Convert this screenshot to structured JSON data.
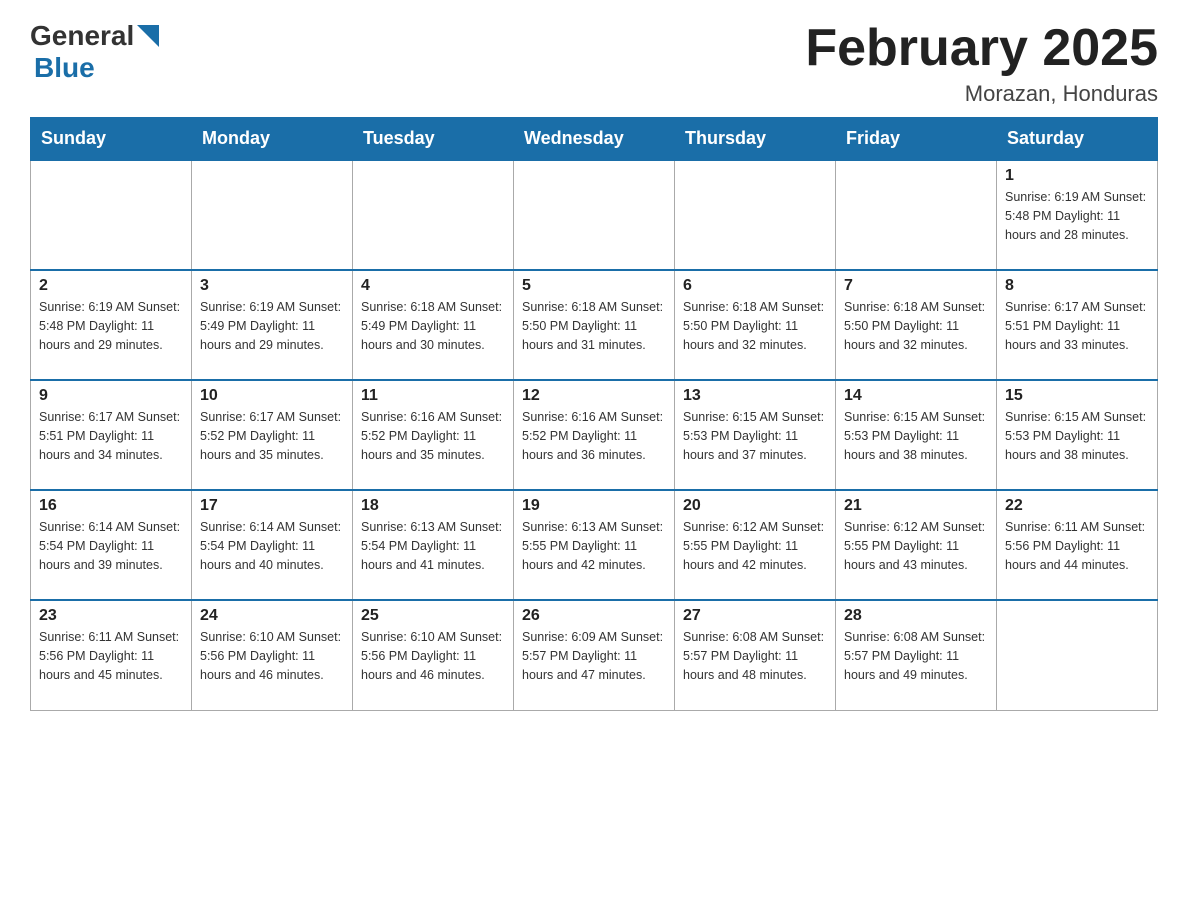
{
  "header": {
    "logo_general": "General",
    "logo_blue": "Blue",
    "title": "February 2025",
    "subtitle": "Morazan, Honduras"
  },
  "weekdays": [
    "Sunday",
    "Monday",
    "Tuesday",
    "Wednesday",
    "Thursday",
    "Friday",
    "Saturday"
  ],
  "weeks": [
    {
      "days": [
        {
          "number": "",
          "info": ""
        },
        {
          "number": "",
          "info": ""
        },
        {
          "number": "",
          "info": ""
        },
        {
          "number": "",
          "info": ""
        },
        {
          "number": "",
          "info": ""
        },
        {
          "number": "",
          "info": ""
        },
        {
          "number": "1",
          "info": "Sunrise: 6:19 AM\nSunset: 5:48 PM\nDaylight: 11 hours\nand 28 minutes."
        }
      ]
    },
    {
      "days": [
        {
          "number": "2",
          "info": "Sunrise: 6:19 AM\nSunset: 5:48 PM\nDaylight: 11 hours\nand 29 minutes."
        },
        {
          "number": "3",
          "info": "Sunrise: 6:19 AM\nSunset: 5:49 PM\nDaylight: 11 hours\nand 29 minutes."
        },
        {
          "number": "4",
          "info": "Sunrise: 6:18 AM\nSunset: 5:49 PM\nDaylight: 11 hours\nand 30 minutes."
        },
        {
          "number": "5",
          "info": "Sunrise: 6:18 AM\nSunset: 5:50 PM\nDaylight: 11 hours\nand 31 minutes."
        },
        {
          "number": "6",
          "info": "Sunrise: 6:18 AM\nSunset: 5:50 PM\nDaylight: 11 hours\nand 32 minutes."
        },
        {
          "number": "7",
          "info": "Sunrise: 6:18 AM\nSunset: 5:50 PM\nDaylight: 11 hours\nand 32 minutes."
        },
        {
          "number": "8",
          "info": "Sunrise: 6:17 AM\nSunset: 5:51 PM\nDaylight: 11 hours\nand 33 minutes."
        }
      ]
    },
    {
      "days": [
        {
          "number": "9",
          "info": "Sunrise: 6:17 AM\nSunset: 5:51 PM\nDaylight: 11 hours\nand 34 minutes."
        },
        {
          "number": "10",
          "info": "Sunrise: 6:17 AM\nSunset: 5:52 PM\nDaylight: 11 hours\nand 35 minutes."
        },
        {
          "number": "11",
          "info": "Sunrise: 6:16 AM\nSunset: 5:52 PM\nDaylight: 11 hours\nand 35 minutes."
        },
        {
          "number": "12",
          "info": "Sunrise: 6:16 AM\nSunset: 5:52 PM\nDaylight: 11 hours\nand 36 minutes."
        },
        {
          "number": "13",
          "info": "Sunrise: 6:15 AM\nSunset: 5:53 PM\nDaylight: 11 hours\nand 37 minutes."
        },
        {
          "number": "14",
          "info": "Sunrise: 6:15 AM\nSunset: 5:53 PM\nDaylight: 11 hours\nand 38 minutes."
        },
        {
          "number": "15",
          "info": "Sunrise: 6:15 AM\nSunset: 5:53 PM\nDaylight: 11 hours\nand 38 minutes."
        }
      ]
    },
    {
      "days": [
        {
          "number": "16",
          "info": "Sunrise: 6:14 AM\nSunset: 5:54 PM\nDaylight: 11 hours\nand 39 minutes."
        },
        {
          "number": "17",
          "info": "Sunrise: 6:14 AM\nSunset: 5:54 PM\nDaylight: 11 hours\nand 40 minutes."
        },
        {
          "number": "18",
          "info": "Sunrise: 6:13 AM\nSunset: 5:54 PM\nDaylight: 11 hours\nand 41 minutes."
        },
        {
          "number": "19",
          "info": "Sunrise: 6:13 AM\nSunset: 5:55 PM\nDaylight: 11 hours\nand 42 minutes."
        },
        {
          "number": "20",
          "info": "Sunrise: 6:12 AM\nSunset: 5:55 PM\nDaylight: 11 hours\nand 42 minutes."
        },
        {
          "number": "21",
          "info": "Sunrise: 6:12 AM\nSunset: 5:55 PM\nDaylight: 11 hours\nand 43 minutes."
        },
        {
          "number": "22",
          "info": "Sunrise: 6:11 AM\nSunset: 5:56 PM\nDaylight: 11 hours\nand 44 minutes."
        }
      ]
    },
    {
      "days": [
        {
          "number": "23",
          "info": "Sunrise: 6:11 AM\nSunset: 5:56 PM\nDaylight: 11 hours\nand 45 minutes."
        },
        {
          "number": "24",
          "info": "Sunrise: 6:10 AM\nSunset: 5:56 PM\nDaylight: 11 hours\nand 46 minutes."
        },
        {
          "number": "25",
          "info": "Sunrise: 6:10 AM\nSunset: 5:56 PM\nDaylight: 11 hours\nand 46 minutes."
        },
        {
          "number": "26",
          "info": "Sunrise: 6:09 AM\nSunset: 5:57 PM\nDaylight: 11 hours\nand 47 minutes."
        },
        {
          "number": "27",
          "info": "Sunrise: 6:08 AM\nSunset: 5:57 PM\nDaylight: 11 hours\nand 48 minutes."
        },
        {
          "number": "28",
          "info": "Sunrise: 6:08 AM\nSunset: 5:57 PM\nDaylight: 11 hours\nand 49 minutes."
        },
        {
          "number": "",
          "info": ""
        }
      ]
    }
  ]
}
